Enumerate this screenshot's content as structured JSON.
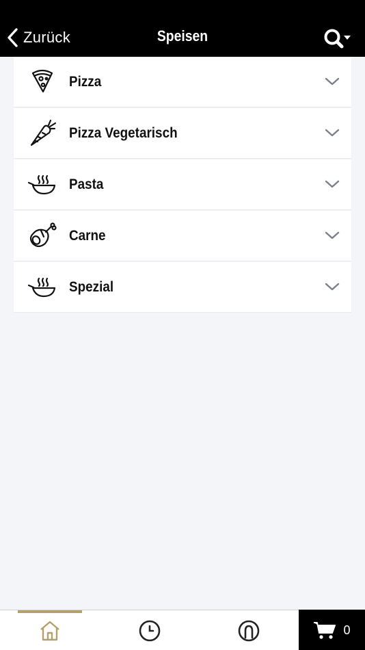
{
  "header": {
    "back_label": "Zurück",
    "title": "Speisen"
  },
  "categories": [
    {
      "label": "Pizza",
      "icon": "pizza-slice-icon"
    },
    {
      "label": "Pizza Vegetarisch",
      "icon": "carrot-icon"
    },
    {
      "label": "Pasta",
      "icon": "steaming-bowl-icon"
    },
    {
      "label": "Carne",
      "icon": "meat-leg-icon"
    },
    {
      "label": "Spezial",
      "icon": "steaming-bowl-icon"
    }
  ],
  "tabbar": {
    "tabs": [
      {
        "name": "home",
        "icon": "home-icon",
        "active": true
      },
      {
        "name": "history",
        "icon": "clock-icon",
        "active": false
      },
      {
        "name": "profile",
        "icon": "user-icon",
        "active": false
      }
    ],
    "cart_count": "0"
  },
  "colors": {
    "header_bg": "#000000",
    "background": "#f4f5f9",
    "accent": "#b3a06a",
    "chevron": "#7a7f88"
  }
}
